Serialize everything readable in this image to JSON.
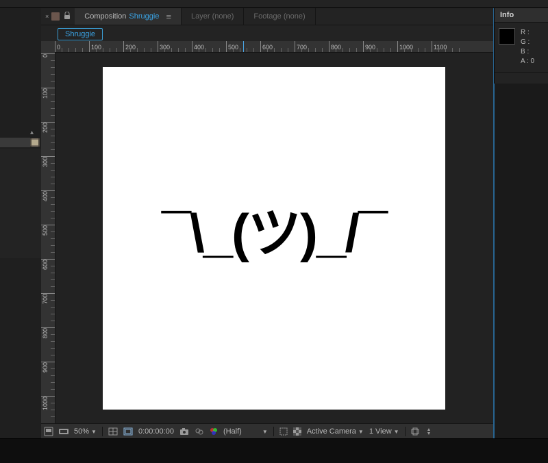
{
  "tabs": {
    "close": "×",
    "composition_label": "Composition",
    "composition_name": "Shruggie",
    "layer_label": "Layer (none)",
    "footage_label": "Footage (none)"
  },
  "subtab": {
    "name": "Shruggie"
  },
  "info": {
    "title": "Info",
    "R": "R :",
    "G": "G :",
    "B": "B :",
    "A": "A :",
    "A_val": "0"
  },
  "canvas": {
    "text": "¯\\_(ツ)_/¯"
  },
  "ruler": {
    "h": [
      "0",
      "100",
      "200",
      "300",
      "400",
      "500",
      "600",
      "700",
      "800",
      "900",
      "1000",
      "1100"
    ],
    "v": [
      "0",
      "100",
      "200",
      "300",
      "400",
      "500",
      "600",
      "700",
      "800",
      "900",
      "1000"
    ]
  },
  "footer": {
    "zoom": "50%",
    "time": "0:00:00:00",
    "resolution": "(Half)",
    "camera": "Active Camera",
    "view": "1 View"
  }
}
